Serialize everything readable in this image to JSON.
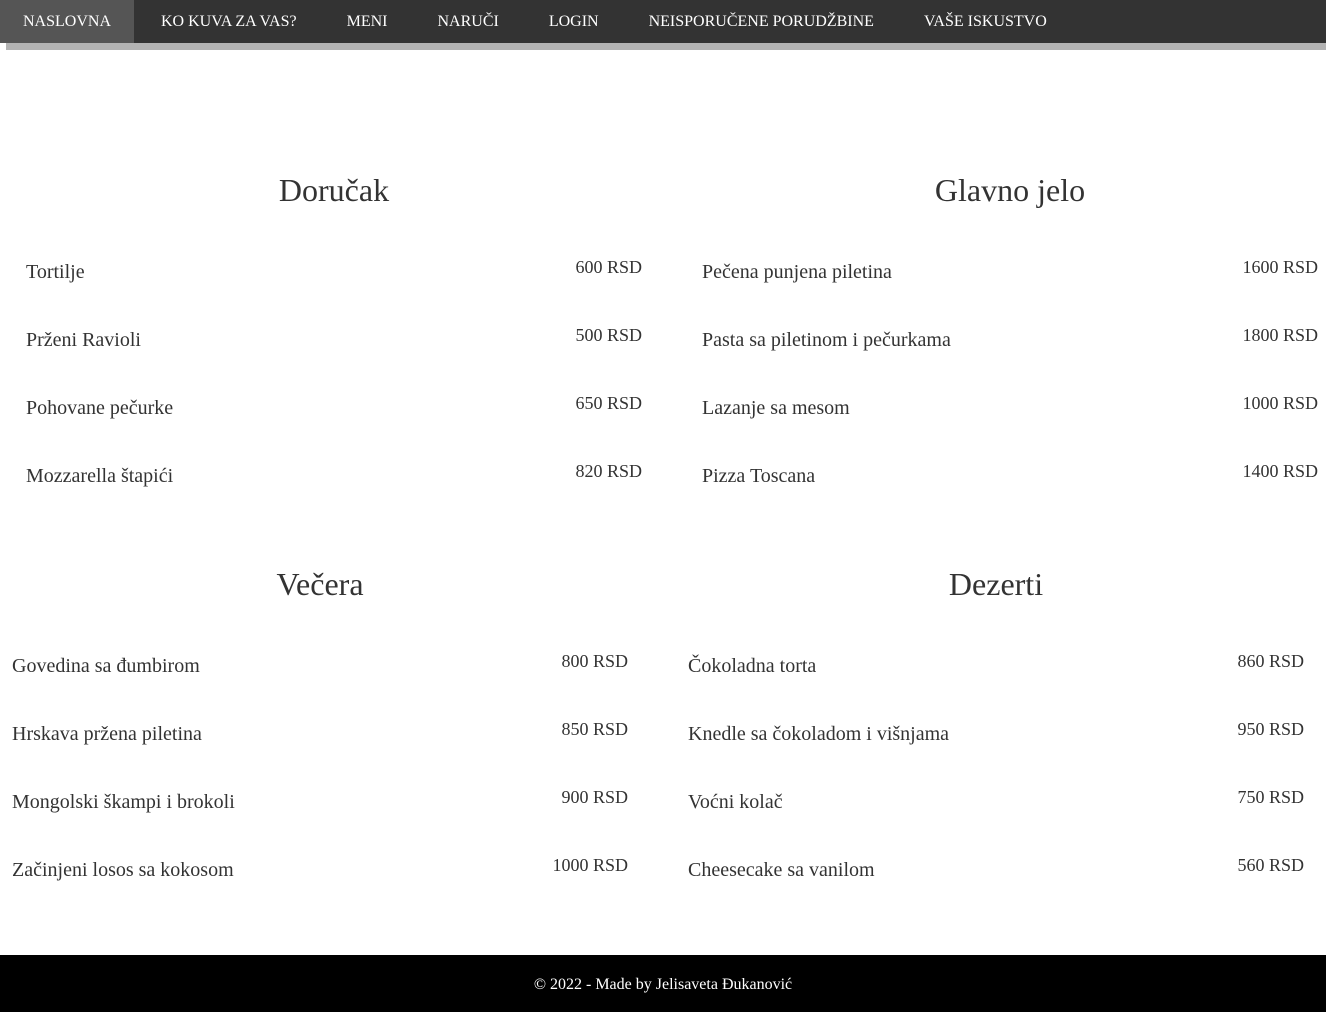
{
  "nav": {
    "items": [
      {
        "label": "NASLOVNA"
      },
      {
        "label": "KO KUVA ZA VAS?"
      },
      {
        "label": "MENI"
      },
      {
        "label": "NARUČI"
      },
      {
        "label": "LOGIN"
      },
      {
        "label": "NEISPORUČENE PORUDŽBINE"
      },
      {
        "label": "VAŠE ISKUSTVO"
      }
    ]
  },
  "sections": [
    {
      "title": "Doručak",
      "items": [
        {
          "name": "Tortilje",
          "price": "600 RSD"
        },
        {
          "name": "Prženi Ravioli",
          "price": "500 RSD"
        },
        {
          "name": "Pohovane pečurke",
          "price": "650 RSD"
        },
        {
          "name": "Mozzarella štapići",
          "price": "820 RSD"
        }
      ]
    },
    {
      "title": "Glavno jelo",
      "items": [
        {
          "name": "Pečena punjena piletina",
          "price": "1600 RSD"
        },
        {
          "name": "Pasta sa piletinom i pečurkama",
          "price": "1800 RSD"
        },
        {
          "name": "Lazanje sa mesom",
          "price": "1000 RSD"
        },
        {
          "name": "Pizza Toscana",
          "price": "1400 RSD"
        }
      ]
    },
    {
      "title": "Večera",
      "items": [
        {
          "name": "Govedina sa đumbirom",
          "price": "800 RSD"
        },
        {
          "name": "Hrskava pržena piletina",
          "price": "850 RSD"
        },
        {
          "name": "Mongolski škampi i brokoli",
          "price": "900 RSD"
        },
        {
          "name": "Začinjeni losos sa kokosom",
          "price": "1000 RSD"
        }
      ]
    },
    {
      "title": "Dezerti",
      "items": [
        {
          "name": "Čokoladna torta",
          "price": "860 RSD"
        },
        {
          "name": "Knedle sa čokoladom i višnjama",
          "price": "950 RSD"
        },
        {
          "name": "Voćni kolač",
          "price": "750 RSD"
        },
        {
          "name": "Cheesecake sa vanilom",
          "price": "560 RSD"
        }
      ]
    }
  ],
  "footer": {
    "text": "© 2022 - Made by Jelisaveta Đukanović"
  }
}
